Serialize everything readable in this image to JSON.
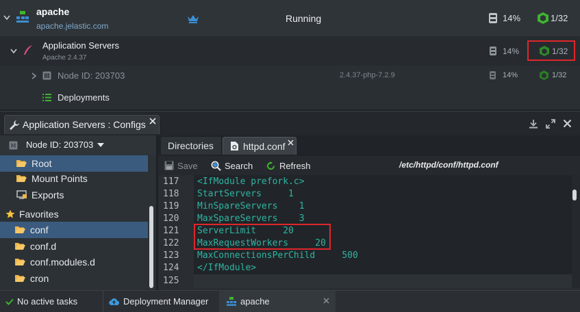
{
  "environment": {
    "name": "apache",
    "domain": "apache.jelastic.com",
    "status": "Running",
    "cpu": "14%",
    "cloudlets": "1/32"
  },
  "app_servers": {
    "title": "Application Servers",
    "version": "Apache 2.4.37",
    "cpu": "14%",
    "cloudlets": "1/32"
  },
  "node": {
    "label": "Node ID: 203703",
    "tag": "2.4.37-php-7.2.9",
    "cpu": "14%",
    "cloudlets": "1/32"
  },
  "deployments": {
    "label": "Deployments"
  },
  "config_window": {
    "tab_title": "Application Servers : Configs",
    "node_selector": "Node ID: 203703",
    "tree": [
      {
        "label": "Root",
        "selected": true
      },
      {
        "label": "Mount Points",
        "selected": false
      },
      {
        "label": "Exports",
        "selected": false
      }
    ],
    "favorites_label": "Favorites",
    "favorites": [
      {
        "label": "conf",
        "selected": true
      },
      {
        "label": "conf.d",
        "selected": false
      },
      {
        "label": "conf.modules.d",
        "selected": false
      },
      {
        "label": "cron",
        "selected": false
      }
    ],
    "tabs": {
      "directories": "Directories",
      "file": "httpd.conf"
    },
    "toolbar": {
      "save": "Save",
      "search": "Search",
      "refresh": "Refresh",
      "path": "/etc/httpd/conf/httpd.conf"
    },
    "code_lines": [
      {
        "n": "117",
        "text": "<IfModule prefork.c>"
      },
      {
        "n": "118",
        "text": "StartServers     1"
      },
      {
        "n": "119",
        "text": "MinSpareServers    1"
      },
      {
        "n": "120",
        "text": "MaxSpareServers    3"
      },
      {
        "n": "121",
        "text": "ServerLimit     20"
      },
      {
        "n": "122",
        "text": "MaxRequestWorkers     20"
      },
      {
        "n": "123",
        "text": "MaxConnectionsPerChild     500"
      },
      {
        "n": "124",
        "text": "</IfModule>"
      },
      {
        "n": "125",
        "text": ""
      }
    ]
  },
  "taskbar": {
    "tasks_status": "No active tasks",
    "deployment_manager": "Deployment Manager",
    "apache_tab": "apache"
  },
  "colors": {
    "accent_green": "#3eb32f",
    "highlight_red": "#e0262a",
    "code_teal": "#2fb5a3",
    "selection_blue": "#3a5b7e"
  }
}
